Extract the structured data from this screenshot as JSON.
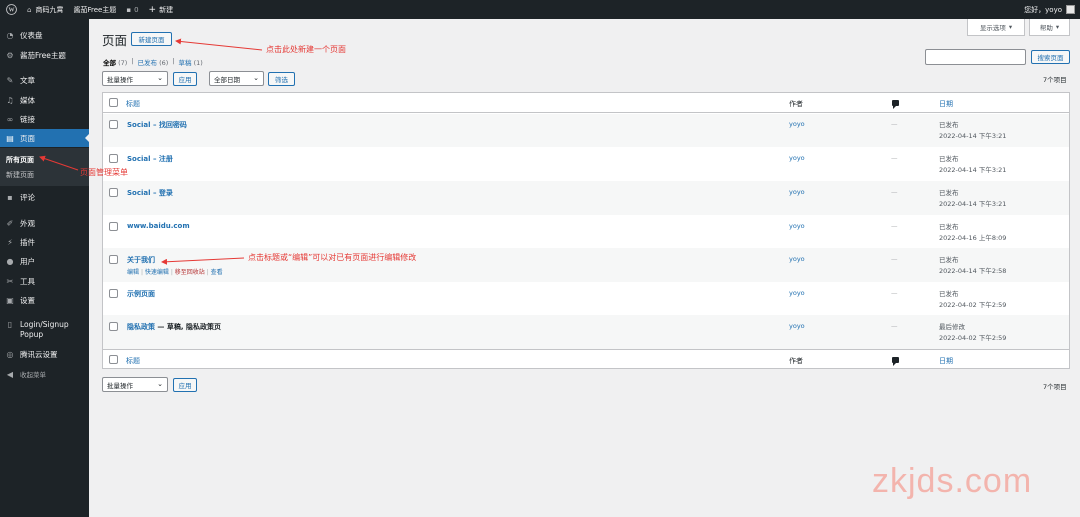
{
  "adminbar": {
    "site_name": "商码九霄",
    "theme_name": "酱茄Free主题",
    "comments_count": "0",
    "new_label": "新建",
    "greeting": "您好，yoyo"
  },
  "sidebar": {
    "items": [
      {
        "label": "仪表盘",
        "icon": "dashboard-icon"
      },
      {
        "label": "酱茄Free主题",
        "icon": "gear-icon"
      },
      {
        "label": "文章",
        "icon": "pin-icon"
      },
      {
        "label": "媒体",
        "icon": "media-icon"
      },
      {
        "label": "链接",
        "icon": "link-icon"
      },
      {
        "label": "页面",
        "icon": "pages-icon"
      },
      {
        "label": "评论",
        "icon": "comment-icon"
      },
      {
        "label": "外观",
        "icon": "brush-icon"
      },
      {
        "label": "插件",
        "icon": "plugin-icon"
      },
      {
        "label": "用户",
        "icon": "user-icon"
      },
      {
        "label": "工具",
        "icon": "wrench-icon"
      },
      {
        "label": "设置",
        "icon": "settings-icon"
      },
      {
        "label": "Login/Signup Popup",
        "icon": "login-icon"
      },
      {
        "label": "腾讯云设置",
        "icon": "globe-icon"
      },
      {
        "label": "收起菜单",
        "icon": "collapse-icon"
      }
    ],
    "submenu": [
      "所有页面",
      "新建页面"
    ]
  },
  "screen_options": "显示选项",
  "help": "帮助",
  "page": {
    "title": "页面",
    "add_new": "新建页面",
    "filters": {
      "all": "全部",
      "all_count": "(7)",
      "published": "已发布",
      "published_count": "(6)",
      "draft": "草稿",
      "draft_count": "(1)",
      "sep": "|"
    },
    "bulk_action": "批量操作",
    "apply": "应用",
    "all_dates": "全部日期",
    "filter": "筛选",
    "search_button": "搜索页面",
    "items_count": "7个项目"
  },
  "table": {
    "headers": {
      "title": "标题",
      "author": "作者",
      "date": "日期"
    },
    "rows": [
      {
        "title": "Social – 找回密码",
        "suffix": "",
        "author": "yoyo",
        "comments": "—",
        "status": "已发布",
        "date": "2022-04-14 下午3:21"
      },
      {
        "title": "Social – 注册",
        "suffix": "",
        "author": "yoyo",
        "comments": "—",
        "status": "已发布",
        "date": "2022-04-14 下午3:21"
      },
      {
        "title": "Social – 登录",
        "suffix": "",
        "author": "yoyo",
        "comments": "—",
        "status": "已发布",
        "date": "2022-04-14 下午3:21"
      },
      {
        "title": "www.baidu.com",
        "suffix": "",
        "author": "yoyo",
        "comments": "—",
        "status": "已发布",
        "date": "2022-04-16 上午8:09"
      },
      {
        "title": "关于我们",
        "suffix": "",
        "author": "yoyo",
        "comments": "—",
        "status": "已发布",
        "date": "2022-04-14 下午2:58"
      },
      {
        "title": "示例页面",
        "suffix": "",
        "author": "yoyo",
        "comments": "—",
        "status": "已发布",
        "date": "2022-04-02 下午2:59"
      },
      {
        "title": "隐私政策",
        "suffix": " — 草稿, 隐私政策页",
        "author": "yoyo",
        "comments": "—",
        "status": "最后修改",
        "date": "2022-04-02 下午2:59"
      }
    ],
    "row_actions": {
      "edit": "编辑",
      "quick_edit": "快速编辑",
      "trash": "移至回收站",
      "view": "查看",
      "sep": "|"
    }
  },
  "annotations": {
    "add_new": "点击此处新建一个页面",
    "menu": "页面管理菜单",
    "edit": "点击标题或“编辑”可以对已有页面进行编辑修改"
  },
  "watermark": "zkjds.com",
  "colors": {
    "accent": "#2271b1",
    "sidebar_bg": "#1d2327",
    "annotation": "#e53935",
    "watermark": "#f3b4ad"
  }
}
